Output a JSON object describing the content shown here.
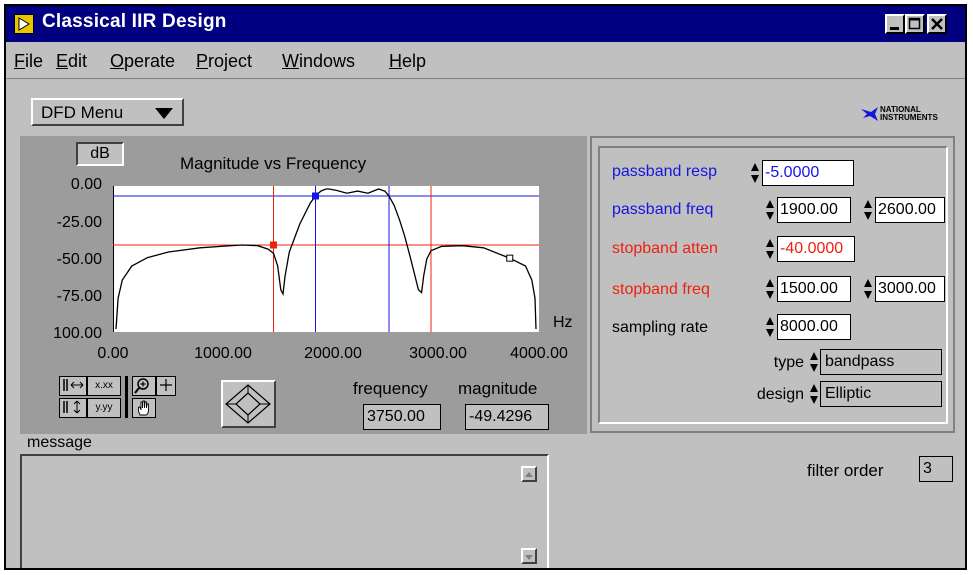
{
  "window": {
    "title": "Classical IIR Design"
  },
  "menu": [
    "File",
    "Edit",
    "Operate",
    "Project",
    "Windows",
    "Help"
  ],
  "dfd_menu": "DFD Menu",
  "logo": {
    "line1": "NATIONAL",
    "line2": "INSTRUMENTS"
  },
  "graph": {
    "title": "Magnitude vs Frequency",
    "scale_button": "dB",
    "x_unit": "Hz",
    "y_ticks": [
      "0.00",
      "-25.00",
      "-50.00",
      "-75.00",
      "100.00"
    ],
    "x_ticks": [
      "0.00",
      "1000.00",
      "2000.00",
      "3000.00",
      "4000.00"
    ],
    "palette": [
      "x.xx",
      "y.yy"
    ],
    "readout": {
      "frequency_label": "frequency",
      "magnitude_label": "magnitude",
      "frequency": "3750.00",
      "magnitude": "-49.4296"
    }
  },
  "chart_data": {
    "type": "line",
    "title": "Magnitude vs Frequency",
    "xlabel": "Hz",
    "ylabel": "dB",
    "xlim": [
      0,
      4000
    ],
    "ylim": [
      -100,
      0
    ],
    "series": [
      {
        "x": [
          0,
          20,
          60,
          150,
          300,
          500,
          800,
          1000,
          1200,
          1350,
          1450,
          1500,
          1540,
          1570,
          1590,
          1610,
          1650,
          1750,
          1850,
          1900,
          1950,
          2000,
          2030,
          2100,
          2200,
          2300,
          2400,
          2500,
          2560,
          2600,
          2650,
          2700,
          2750,
          2800,
          2850,
          2880,
          2910,
          2930,
          2960,
          3000,
          3100,
          3300,
          3500,
          3750,
          3900,
          3960,
          3990,
          4000
        ],
        "y": [
          -100,
          -78,
          -65,
          -55,
          -49,
          -45,
          -42,
          -41,
          -40,
          -40.5,
          -43,
          -46,
          -55,
          -72,
          -75,
          -62,
          -45,
          -25,
          -10,
          -5,
          -1.5,
          0,
          0,
          -1,
          -3,
          -1.5,
          -3,
          0,
          -1.5,
          -5,
          -12,
          -22,
          -34,
          -48,
          -63,
          -72,
          -74,
          -62,
          -50,
          -44,
          -41,
          -40.5,
          -42,
          -49.4,
          -55,
          -65,
          -78,
          -100
        ]
      }
    ],
    "markers": [
      {
        "color": "#1515e0",
        "x": 1900,
        "y": -5
      },
      {
        "color": "#f02010",
        "x": 1500,
        "y": -40
      },
      {
        "color": "#000000",
        "x": 3750,
        "y": -49.4
      }
    ],
    "cursor_lines": [
      {
        "color": "#1515e0",
        "orientation": "horizontal",
        "value": -5
      },
      {
        "color": "#f02010",
        "orientation": "horizontal",
        "value": -40
      },
      {
        "color": "#1515e0",
        "orientation": "vertical",
        "value": 1900
      },
      {
        "color": "#1515e0",
        "orientation": "vertical",
        "value": 2600
      },
      {
        "color": "#f02010",
        "orientation": "vertical",
        "value": 1500
      },
      {
        "color": "#f02010",
        "orientation": "vertical",
        "value": 3000
      }
    ],
    "curve_color": "#000000",
    "plot_background": "#ffffff"
  },
  "specs": {
    "passband_resp": {
      "label": "passband resp",
      "value": "-5.0000"
    },
    "passband_freq": {
      "label": "passband freq",
      "low": "1900.00",
      "high": "2600.00"
    },
    "stopband_atten": {
      "label": "stopband atten",
      "value": "-40.0000"
    },
    "stopband_freq": {
      "label": "stopband freq",
      "low": "1500.00",
      "high": "3000.00"
    },
    "sampling_rate": {
      "label": "sampling rate",
      "value": "8000.00"
    },
    "type": {
      "label": "type",
      "value": "bandpass"
    },
    "design": {
      "label": "design",
      "value": "Elliptic"
    }
  },
  "message": {
    "label": "message",
    "text": ""
  },
  "filter_order": {
    "label": "filter order",
    "value": "3"
  },
  "colors": {
    "passband": "#1515e0",
    "stopband": "#f02010",
    "titlebar": "#000080",
    "panel": "#c0c0c0",
    "graph_panel": "#9c9c9c"
  }
}
